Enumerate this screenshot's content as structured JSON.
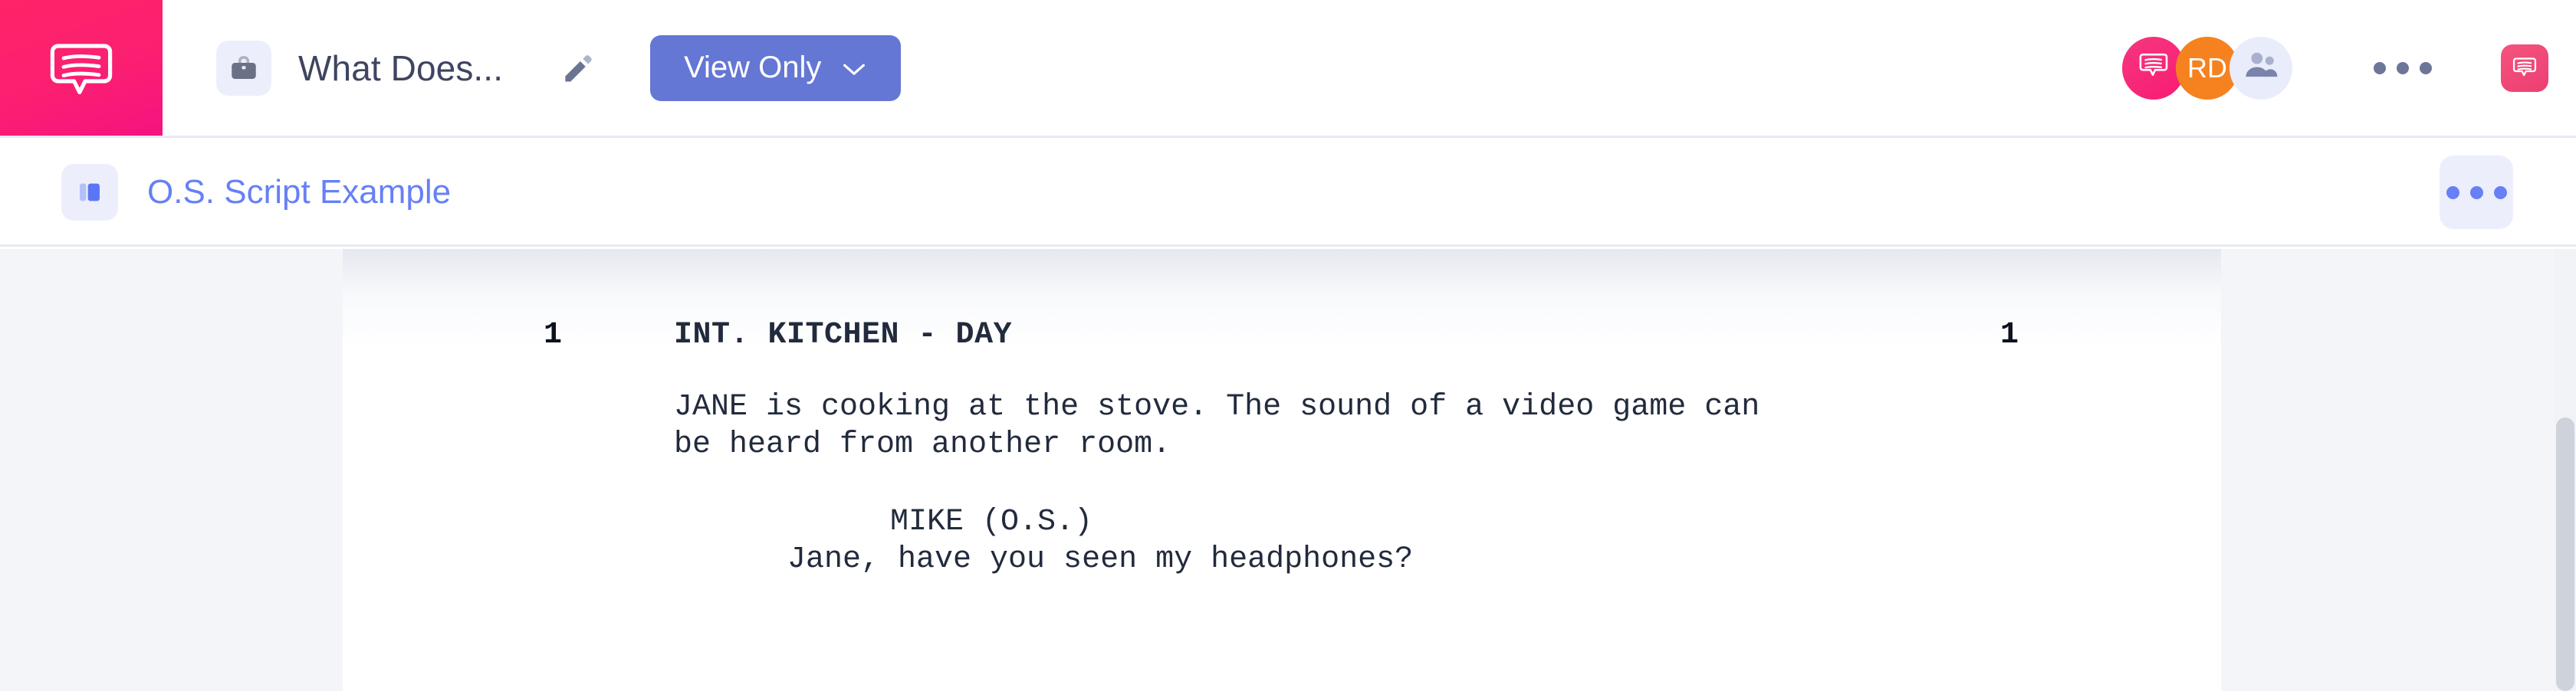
{
  "app": {
    "brand_icon": "speech-bubble-icon",
    "brand_color": "#fb1f72",
    "accent_blue": "#6780f5",
    "button_blue": "#6577d4"
  },
  "header": {
    "project_icon": "briefcase-icon",
    "document_title": "What Does...",
    "edit_icon": "pencil-icon",
    "mode_button": {
      "label": "View Only",
      "chevron": "chevron-down-icon"
    },
    "avatars": [
      {
        "type": "logo",
        "icon": "speech-bubble-icon",
        "initials": "",
        "color": "#f81b72"
      },
      {
        "type": "initials",
        "icon": "",
        "initials": "RD",
        "color": "#f5821f"
      },
      {
        "type": "group",
        "icon": "people-icon",
        "initials": "",
        "color": "#e9ecfa"
      }
    ],
    "overflow_menu": "ellipsis-icon",
    "chat_button": "speech-bubble-icon"
  },
  "breadcrumb": {
    "icon": "document-panels-icon",
    "label": "O.S. Script Example",
    "overflow_menu": "ellipsis-icon"
  },
  "script": {
    "scene_number_left": "1",
    "scene_number_right": "1",
    "scene_heading": "INT. KITCHEN - DAY",
    "action": "JANE is cooking at the stove. The sound of a video game can\nbe heard from another room.",
    "character_cue": "MIKE (O.S.)",
    "dialogue": "Jane, have you seen my headphones?"
  }
}
